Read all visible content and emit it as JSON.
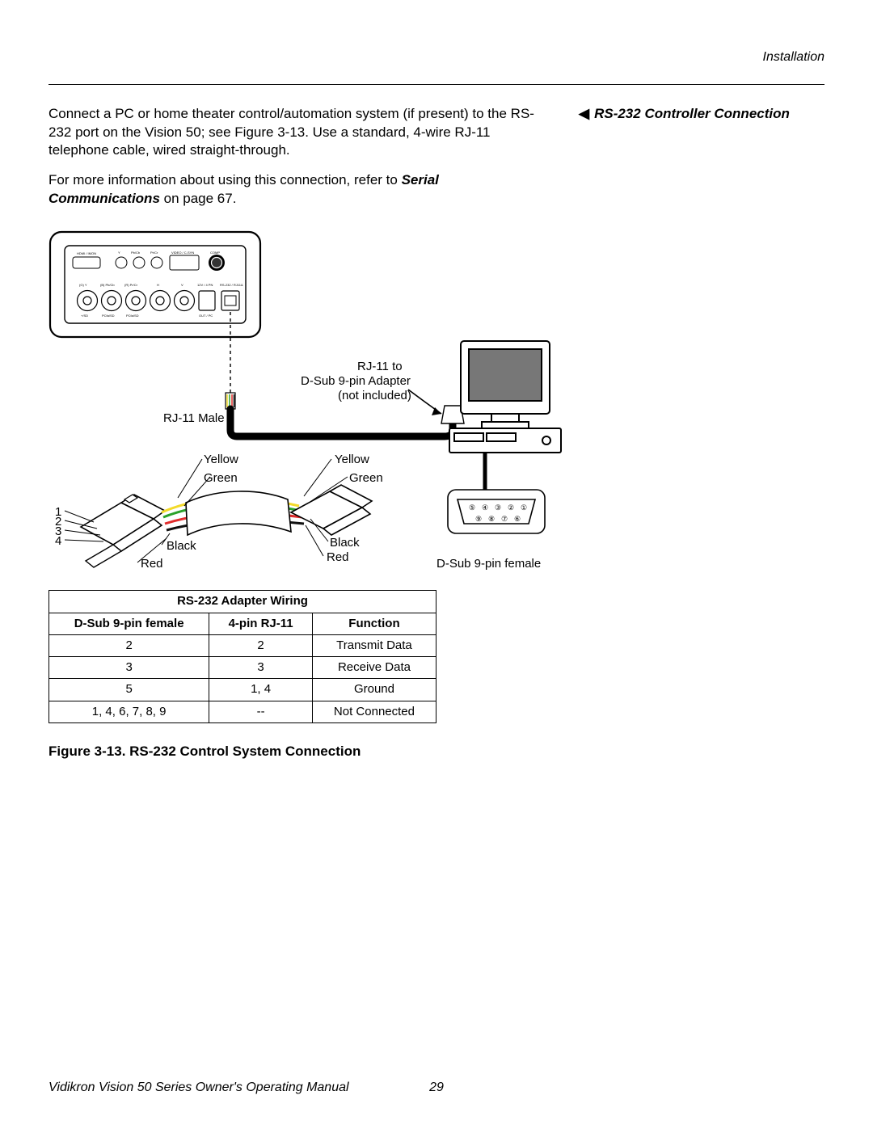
{
  "header": {
    "chapter": "Installation"
  },
  "side": {
    "section_title": "RS-232 Controller Connection"
  },
  "body": {
    "p1_a": "Connect a PC or home theater control/automation system (if present) to the RS-232 port on the Vision 50; see Figure 3-13. Use a standard, 4-wire RJ-11 telephone cable, wired straight-through.",
    "p2_a": "For more information about using this connection, refer to ",
    "p2_b": "Serial Communications",
    "p2_c": " on page 67."
  },
  "diagram": {
    "rj11_to": "RJ-11 to",
    "dsub_adapter": "D-Sub 9-pin Adapter",
    "not_included": "(not included)",
    "rj11_male": "RJ-11 Male",
    "yellow": "Yellow",
    "green": "Green",
    "black": "Black",
    "red": "Red",
    "dsub_female": "D-Sub 9-pin female",
    "n1": "1",
    "n2": "2",
    "n3": "3",
    "n4": "4"
  },
  "table": {
    "title": "RS-232 Adapter Wiring",
    "h1": "D-Sub 9-pin female",
    "h2": "4-pin RJ-11",
    "h3": "Function",
    "rows": [
      {
        "c1": "2",
        "c2": "2",
        "c3": "Transmit Data"
      },
      {
        "c1": "3",
        "c2": "3",
        "c3": "Receive Data"
      },
      {
        "c1": "5",
        "c2": "1, 4",
        "c3": "Ground"
      },
      {
        "c1": "1, 4, 6, 7, 8, 9",
        "c2": "--",
        "c3": "Not Connected"
      }
    ]
  },
  "caption": "Figure 3-13. RS-232 Control System Connection",
  "footer": {
    "manual": "Vidikron Vision 50 Series Owner's Operating Manual",
    "page": "29"
  }
}
